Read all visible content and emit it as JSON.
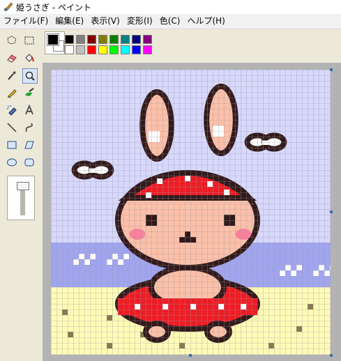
{
  "window": {
    "title": "姫うさぎ - ペイント",
    "app_icon": "paint-app-icon"
  },
  "menu": [
    "ファイル(F)",
    "編集(E)",
    "表示(V)",
    "変形(I)",
    "色(C)",
    "ヘルプ(H)"
  ],
  "tools": [
    {
      "name": "free-form-select",
      "icon": "lasso-icon",
      "selected": false
    },
    {
      "name": "rect-select",
      "icon": "select-rect-icon",
      "selected": false
    },
    {
      "name": "eraser",
      "icon": "eraser-icon",
      "selected": false
    },
    {
      "name": "fill",
      "icon": "paint-bucket-icon",
      "selected": false
    },
    {
      "name": "pick-color",
      "icon": "eyedropper-icon",
      "selected": false
    },
    {
      "name": "magnifier",
      "icon": "magnifier-icon",
      "selected": true
    },
    {
      "name": "pencil",
      "icon": "pencil-icon",
      "selected": false
    },
    {
      "name": "brush",
      "icon": "brush-icon",
      "selected": false
    },
    {
      "name": "airbrush",
      "icon": "airbrush-icon",
      "selected": false
    },
    {
      "name": "text",
      "icon": "text-A-icon",
      "selected": false
    },
    {
      "name": "line",
      "icon": "line-icon",
      "selected": false
    },
    {
      "name": "curve",
      "icon": "curve-icon",
      "selected": false
    },
    {
      "name": "rectangle",
      "icon": "rectangle-icon",
      "selected": false
    },
    {
      "name": "polygon",
      "icon": "polygon-icon",
      "selected": false
    },
    {
      "name": "ellipse",
      "icon": "ellipse-icon",
      "selected": false
    },
    {
      "name": "rounded-rectangle",
      "icon": "rounded-rect-icon",
      "selected": false
    }
  ],
  "colors": {
    "foreground": "#000000",
    "background": "#ffffff",
    "palette_top": [
      "#000000",
      "#808080",
      "#800000",
      "#808000",
      "#008000",
      "#008080",
      "#000080",
      "#800080"
    ],
    "palette_bottom": [
      "#ffffff",
      "#c0c0c0",
      "#ff0000",
      "#ffff00",
      "#00ff00",
      "#00ffff",
      "#0000ff",
      "#ff00ff"
    ]
  },
  "canvas": {
    "zoom_view": "pixel-grid",
    "image_subject": "bunny-in-swim-ring-pixel-art",
    "scene_colors": {
      "sky": "#d7d8fb",
      "water": "#a1a5ef",
      "sand": "#fffbb6",
      "skin": "#fcc0a8",
      "red": "#ee1c24",
      "outline": "#331a1a",
      "cheek": "#ff7f9a",
      "cloud": "#ffffff",
      "grid": "#9a9aa8"
    }
  }
}
